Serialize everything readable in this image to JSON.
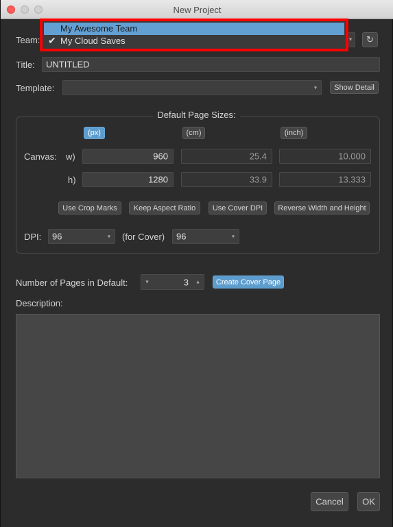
{
  "window": {
    "title": "New Project"
  },
  "team": {
    "label": "Team:",
    "options": [
      {
        "label": "My Awesome Team",
        "highlighted": true,
        "checked": false
      },
      {
        "label": "My Cloud Saves",
        "highlighted": false,
        "checked": true
      }
    ],
    "checkmark": "✔",
    "refresh_icon": "↻",
    "caret": "▾"
  },
  "title_field": {
    "label": "Title:",
    "value": "UNTITLED"
  },
  "template": {
    "label": "Template:",
    "value": "",
    "show_detail": "Show Detail",
    "caret": "▾"
  },
  "page_sizes": {
    "heading": "Default Page Sizes:",
    "units": [
      "(px)",
      "(cm)",
      "(inch)"
    ],
    "canvas_label": "Canvas:",
    "w_label": "w)",
    "h_label": "h)",
    "width": {
      "px": "960",
      "cm": "25.4",
      "inch": "10.000"
    },
    "height": {
      "px": "1280",
      "cm": "33.9",
      "inch": "13.333"
    },
    "buttons": [
      "Use Crop Marks",
      "Keep Aspect Ratio",
      "Use Cover DPI",
      "Reverse Width and Height"
    ],
    "dpi_label": "DPI:",
    "dpi_value": "96",
    "cover_label": "(for Cover)",
    "cover_dpi_value": "96"
  },
  "pages": {
    "label": "Number of Pages in Default:",
    "value": "3",
    "create_cover": "Create Cover Page",
    "down_arrow": "▼",
    "up_arrow": "▲"
  },
  "description": {
    "label": "Description:",
    "value": ""
  },
  "footer": {
    "cancel": "Cancel",
    "ok": "OK"
  },
  "colors": {
    "accent": "#5d9dce",
    "highlight_border": "#ff0000",
    "background": "#2c2c2c"
  }
}
